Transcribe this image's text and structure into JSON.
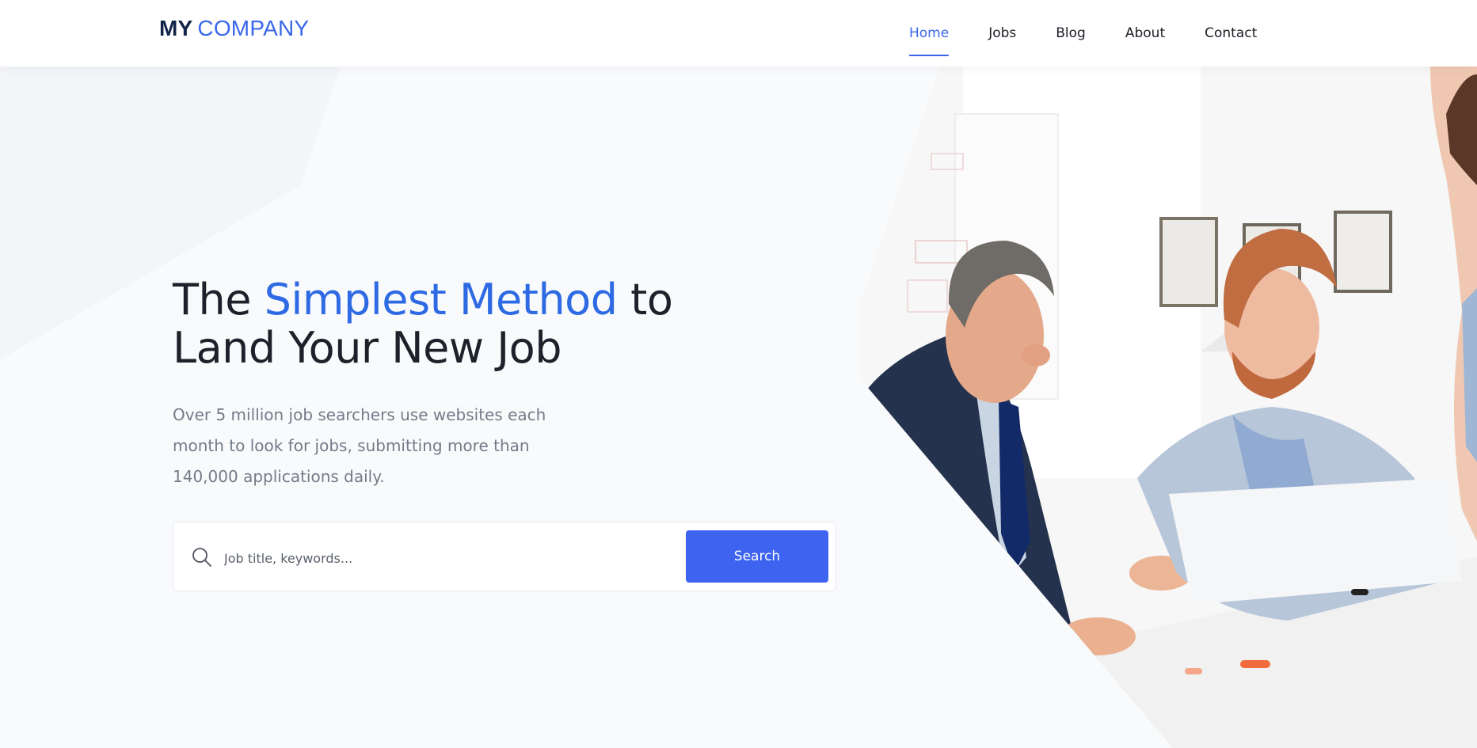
{
  "header": {
    "logo": {
      "bold": "MY",
      "light": "COMPANY"
    },
    "nav": {
      "items": [
        {
          "label": "Home",
          "active": true
        },
        {
          "label": "Jobs",
          "active": false
        },
        {
          "label": "Blog",
          "active": false
        },
        {
          "label": "About",
          "active": false
        },
        {
          "label": "Contact",
          "active": false
        }
      ]
    }
  },
  "hero": {
    "headline": {
      "part1": "The ",
      "accent": "Simplest Method",
      "part2": " to",
      "line2": "Land Your New Job"
    },
    "subtitle": "Over 5 million job searchers use websites each month to look for jobs, submitting more than 140,000 applications daily.",
    "search": {
      "icon": "search-icon",
      "placeholder": "Job title, keywords...",
      "button_label": "Search"
    },
    "image": {
      "subject": "office-meeting-photo"
    }
  },
  "colors": {
    "accent": "#3a67ea",
    "headline_accent": "#2d6ae3",
    "button": "#3d63f0",
    "logo_dark": "#12244a",
    "text_dark": "#1d2129",
    "text_muted": "#737b88",
    "background": "#f9fafc"
  }
}
